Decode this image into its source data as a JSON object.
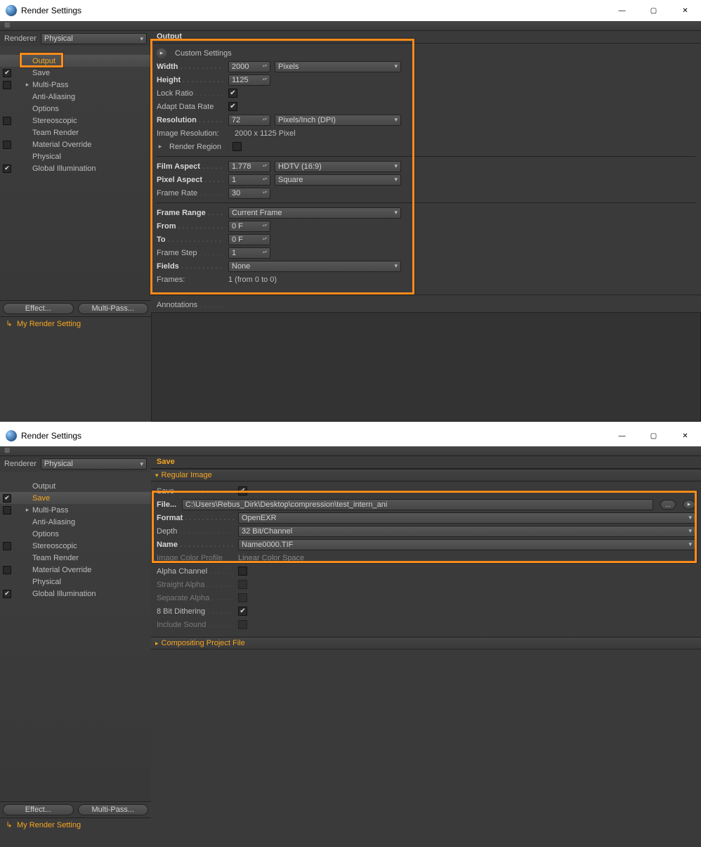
{
  "shared": {
    "window_title": "Render Settings",
    "renderer_label": "Renderer",
    "renderer_value": "Physical",
    "effect_btn": "Effect...",
    "multipass_btn": "Multi-Pass...",
    "preset_name": "My Render Setting"
  },
  "win1": {
    "tree": [
      {
        "label": "Output",
        "checked": null,
        "selected": true,
        "expander": false
      },
      {
        "label": "Save",
        "checked": true,
        "selected": false,
        "expander": false
      },
      {
        "label": "Multi-Pass",
        "checked": false,
        "selected": false,
        "expander": true
      },
      {
        "label": "Anti-Aliasing",
        "checked": null,
        "selected": false,
        "expander": false
      },
      {
        "label": "Options",
        "checked": null,
        "selected": false,
        "expander": false
      },
      {
        "label": "Stereoscopic",
        "checked": false,
        "selected": false,
        "expander": false
      },
      {
        "label": "Team Render",
        "checked": null,
        "selected": false,
        "expander": false
      },
      {
        "label": "Material Override",
        "checked": false,
        "selected": false,
        "expander": false
      },
      {
        "label": "Physical",
        "checked": null,
        "selected": false,
        "expander": false
      },
      {
        "label": "Global Illumination",
        "checked": true,
        "selected": false,
        "expander": false
      }
    ],
    "panel_title": "Output",
    "custom_settings_label": "Custom Settings",
    "rows": {
      "width": {
        "label": "Width",
        "value": "2000",
        "unit": "Pixels"
      },
      "height": {
        "label": "Height",
        "value": "1125"
      },
      "lockratio": {
        "label": "Lock Ratio",
        "checked": true
      },
      "adaptdata": {
        "label": "Adapt Data Rate",
        "checked": true
      },
      "resolution": {
        "label": "Resolution",
        "value": "72",
        "unit": "Pixels/Inch (DPI)"
      },
      "imgres": {
        "label": "Image Resolution:",
        "value": "2000 x 1125 Pixel"
      },
      "renderregion": {
        "label": "Render Region",
        "checked": false,
        "expander": true
      },
      "filmaspect": {
        "label": "Film Aspect",
        "value": "1.778",
        "preset": "HDTV (16:9)"
      },
      "pixelaspect": {
        "label": "Pixel Aspect",
        "value": "1",
        "preset": "Square"
      },
      "framerate": {
        "label": "Frame Rate",
        "value": "30"
      },
      "framerange": {
        "label": "Frame Range",
        "value": "Current Frame"
      },
      "from": {
        "label": "From",
        "value": "0 F"
      },
      "to": {
        "label": "To",
        "value": "0 F"
      },
      "framestep": {
        "label": "Frame Step",
        "value": "1"
      },
      "fields": {
        "label": "Fields",
        "value": "None"
      },
      "frames": {
        "label": "Frames:",
        "value": "1 (from 0 to 0)"
      },
      "annotations": {
        "label": "Annotations"
      }
    }
  },
  "win2": {
    "tree": [
      {
        "label": "Output",
        "checked": null,
        "selected": false,
        "expander": false
      },
      {
        "label": "Save",
        "checked": true,
        "selected": true,
        "expander": false
      },
      {
        "label": "Multi-Pass",
        "checked": false,
        "selected": false,
        "expander": true
      },
      {
        "label": "Anti-Aliasing",
        "checked": null,
        "selected": false,
        "expander": false
      },
      {
        "label": "Options",
        "checked": null,
        "selected": false,
        "expander": false
      },
      {
        "label": "Stereoscopic",
        "checked": false,
        "selected": false,
        "expander": false
      },
      {
        "label": "Team Render",
        "checked": null,
        "selected": false,
        "expander": false
      },
      {
        "label": "Material Override",
        "checked": false,
        "selected": false,
        "expander": false
      },
      {
        "label": "Physical",
        "checked": null,
        "selected": false,
        "expander": false
      },
      {
        "label": "Global Illumination",
        "checked": true,
        "selected": false,
        "expander": false
      }
    ],
    "panel_title": "Save",
    "regular_image_label": "Regular Image",
    "rows": {
      "save": {
        "label": "Save",
        "checked": true
      },
      "file": {
        "label": "File...",
        "value": "C:\\Users\\Rebus_Dirk\\Desktop\\compression\\test_intern_ani",
        "browse": "...",
        "go": "▸"
      },
      "format": {
        "label": "Format",
        "value": "OpenEXR"
      },
      "depth": {
        "label": "Depth",
        "value": "32 Bit/Channel"
      },
      "name": {
        "label": "Name",
        "value": "Name0000.TIF"
      },
      "profile": {
        "label": "Image Color Profile",
        "value": "Linear Color Space"
      },
      "alpha": {
        "label": "Alpha Channel",
        "checked": false
      },
      "straight": {
        "label": "Straight Alpha",
        "checked": false,
        "disabled": true
      },
      "separate": {
        "label": "Separate Alpha",
        "checked": false,
        "disabled": true
      },
      "dither": {
        "label": "8 Bit Dithering",
        "checked": true
      },
      "sound": {
        "label": "Include Sound",
        "checked": false,
        "disabled": true
      }
    },
    "compositing_label": "Compositing Project File"
  }
}
